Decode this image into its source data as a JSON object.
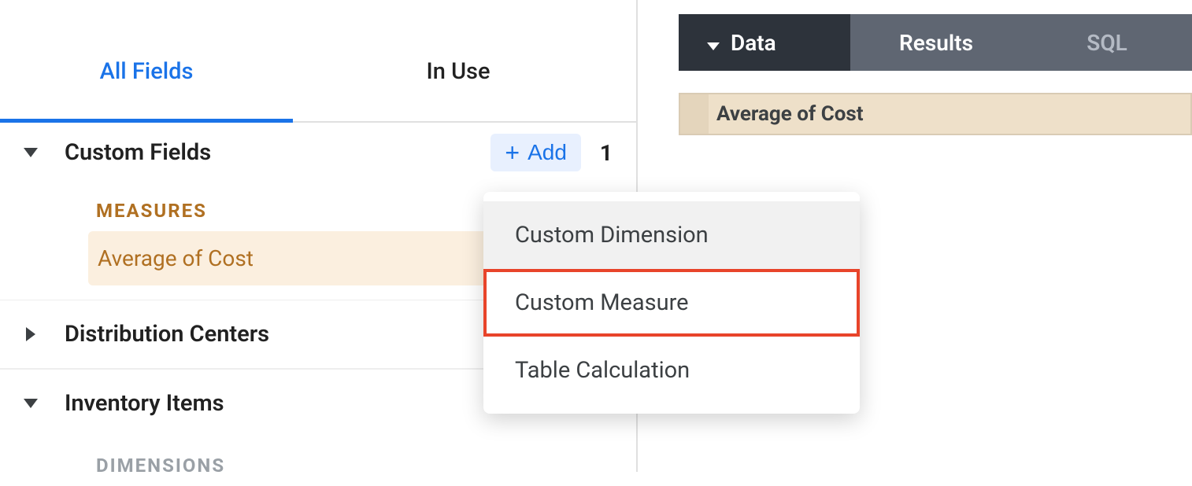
{
  "tabs": {
    "all_fields": "All Fields",
    "in_use": "In Use"
  },
  "sections": {
    "custom_fields": {
      "title": "Custom Fields",
      "add_label": "Add",
      "count": "1",
      "subheader_measures": "MEASURES",
      "items": [
        "Average of Cost"
      ]
    },
    "distribution_centers": {
      "title": "Distribution Centers"
    },
    "inventory_items": {
      "title": "Inventory Items",
      "subheader_dimensions": "DIMENSIONS"
    }
  },
  "dropdown": {
    "items": [
      "Custom Dimension",
      "Custom Measure",
      "Table Calculation"
    ]
  },
  "right": {
    "tabs": {
      "data": "Data",
      "results": "Results",
      "sql": "SQL"
    },
    "result_header": "Average of Cost"
  }
}
